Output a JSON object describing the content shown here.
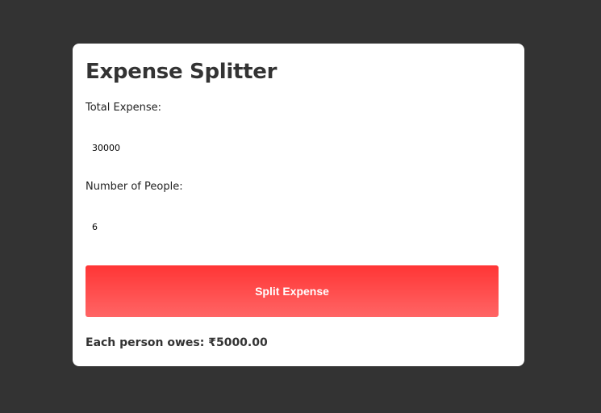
{
  "app": {
    "title": "Expense Splitter"
  },
  "form": {
    "total_label": "Total Expense:",
    "total_value": "30000",
    "people_label": "Number of People:",
    "people_value": "6",
    "submit_label": "Split Expense"
  },
  "result": {
    "text": "Each person owes: ₹5000.00"
  },
  "colors": {
    "background": "#333333",
    "card": "#ffffff",
    "button_gradient_top": "#ff3535",
    "button_gradient_bottom": "#ff6565",
    "text": "#333333"
  }
}
